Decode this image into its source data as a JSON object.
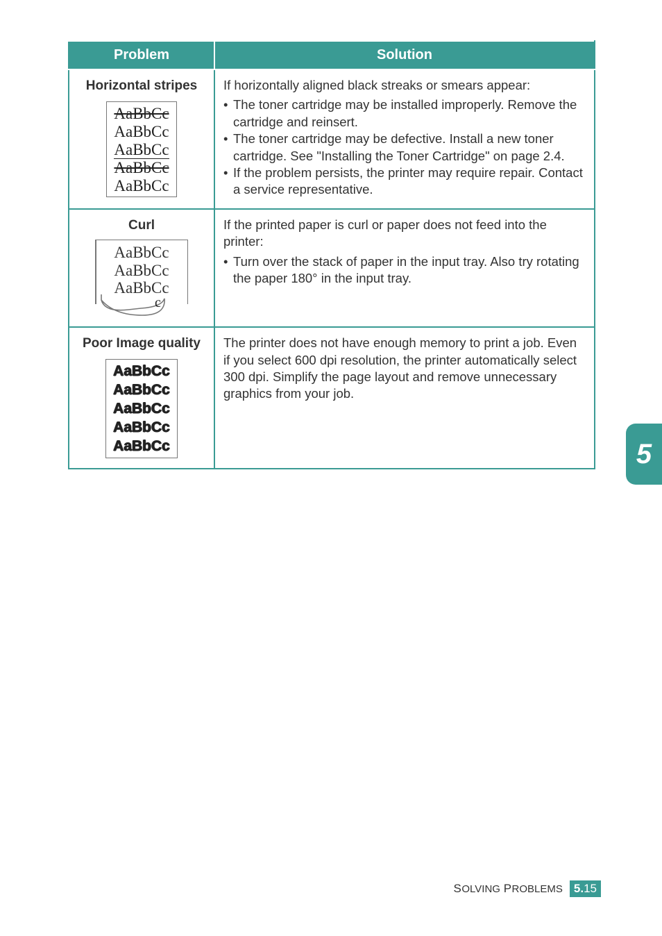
{
  "table": {
    "headers": {
      "problem": "Problem",
      "solution": "Solution"
    },
    "rows": [
      {
        "title": "Horizontal stripes",
        "sample": [
          "AaBbCc",
          "AaBbCc",
          "AaBbCc",
          "AaBbCc",
          "AaBbCc"
        ],
        "intro": "If horizontally aligned black streaks or smears appear:",
        "bullets": [
          "The toner cartridge may be installed improperly. Remove the cartridge and reinsert.",
          "The toner cartridge may be defective. Install a new toner cartridge. See \"Installing the Toner Cartridge\" on page 2.4.",
          "If the problem persists, the printer may require repair. Contact a service representative."
        ]
      },
      {
        "title": "Curl",
        "sample": [
          "AaBbCc",
          "AaBbCc",
          "AaBbCc"
        ],
        "intro": "If the printed paper is curl or paper does not feed into the printer:",
        "bullets": [
          "Turn over the stack of paper in the input tray. Also try rotating the paper 180° in the input tray."
        ]
      },
      {
        "title": "Poor Image quality",
        "sample": [
          "AaBbCc",
          "AaBbCc",
          "AaBbCc",
          "AaBbCc",
          "AaBbCc"
        ],
        "body": "The printer does not have enough memory to print a job. Even if you select 600 dpi resolution, the printer automatically select 300 dpi. Simplify the page layout and remove unnecessary graphics from your job."
      }
    ]
  },
  "sideTab": "5",
  "footer": {
    "section_word1": "Solving",
    "section_word2": "Problems",
    "chapter": "5.",
    "page": "15"
  }
}
